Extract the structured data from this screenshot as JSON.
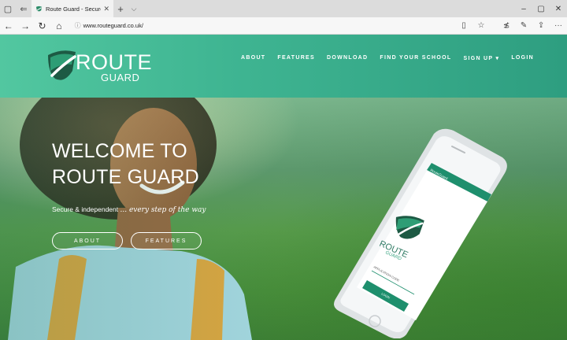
{
  "browser": {
    "tab_title": "Route Guard - Secure &",
    "url": "www.routeguard.co.uk/"
  },
  "site": {
    "logo_line1": "ROUTE",
    "logo_line2": "GUARD",
    "nav": [
      "ABOUT",
      "FEATURES",
      "DOWNLOAD",
      "FIND YOUR SCHOOL",
      "SIGN UP ▾",
      "LOGIN"
    ]
  },
  "hero": {
    "title": "WELCOME TO\nROUTE GUARD",
    "subtitle_plain": "Secure & independent",
    "subtitle_script": "... every step of the way",
    "btn_about": "ABOUT",
    "btn_features": "FEATURES"
  },
  "phone_screen": {
    "app_bar": "RouteGuard",
    "logo_line1": "ROUTE",
    "logo_line2": "GUARD",
    "field": "APPLICATION CODE",
    "button": "LOGIN"
  },
  "colors": {
    "header_green": "#3fb592",
    "shield_dark": "#1d5a44",
    "shield_mid": "#2e8c6a"
  }
}
